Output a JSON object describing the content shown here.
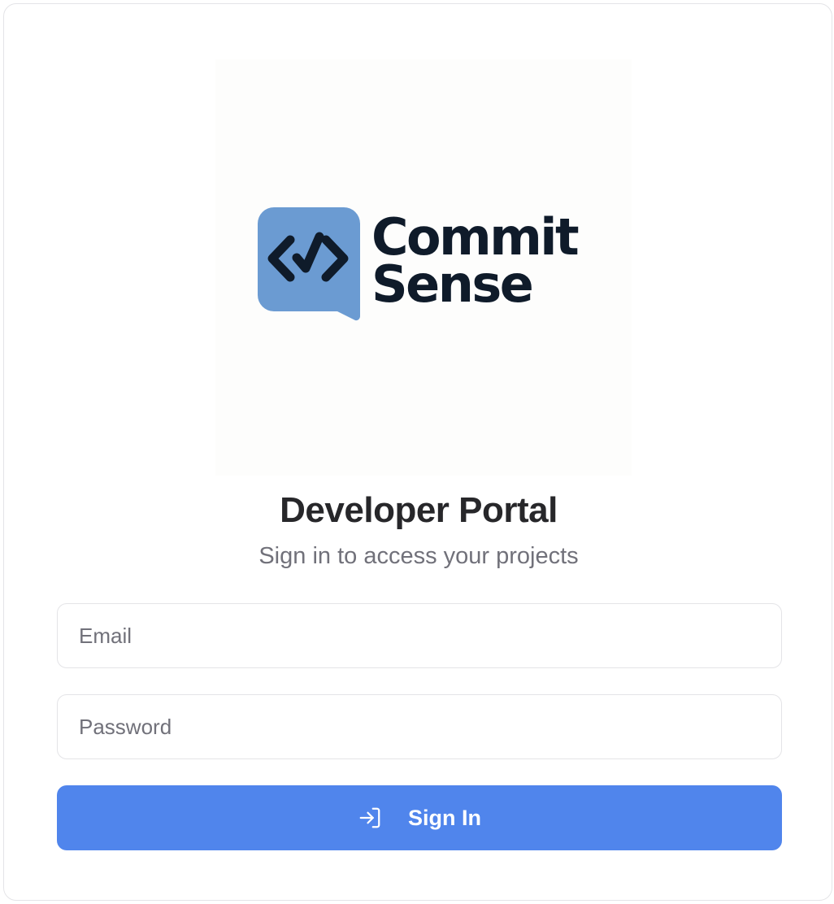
{
  "logo": {
    "wordmark_line1": "Commit",
    "wordmark_line2": "Sense",
    "mark_icon": "code-check-chat-bubble-icon",
    "mark_color": "#6b9bd2",
    "wordmark_color": "#0f1b2a"
  },
  "header": {
    "title": "Developer Portal",
    "subtitle": "Sign in to access your projects"
  },
  "form": {
    "email": {
      "placeholder": "Email",
      "value": ""
    },
    "password": {
      "placeholder": "Password",
      "value": ""
    },
    "submit": {
      "label": "Sign In",
      "icon": "sign-in-arrow-icon",
      "color": "#5085ec"
    }
  }
}
